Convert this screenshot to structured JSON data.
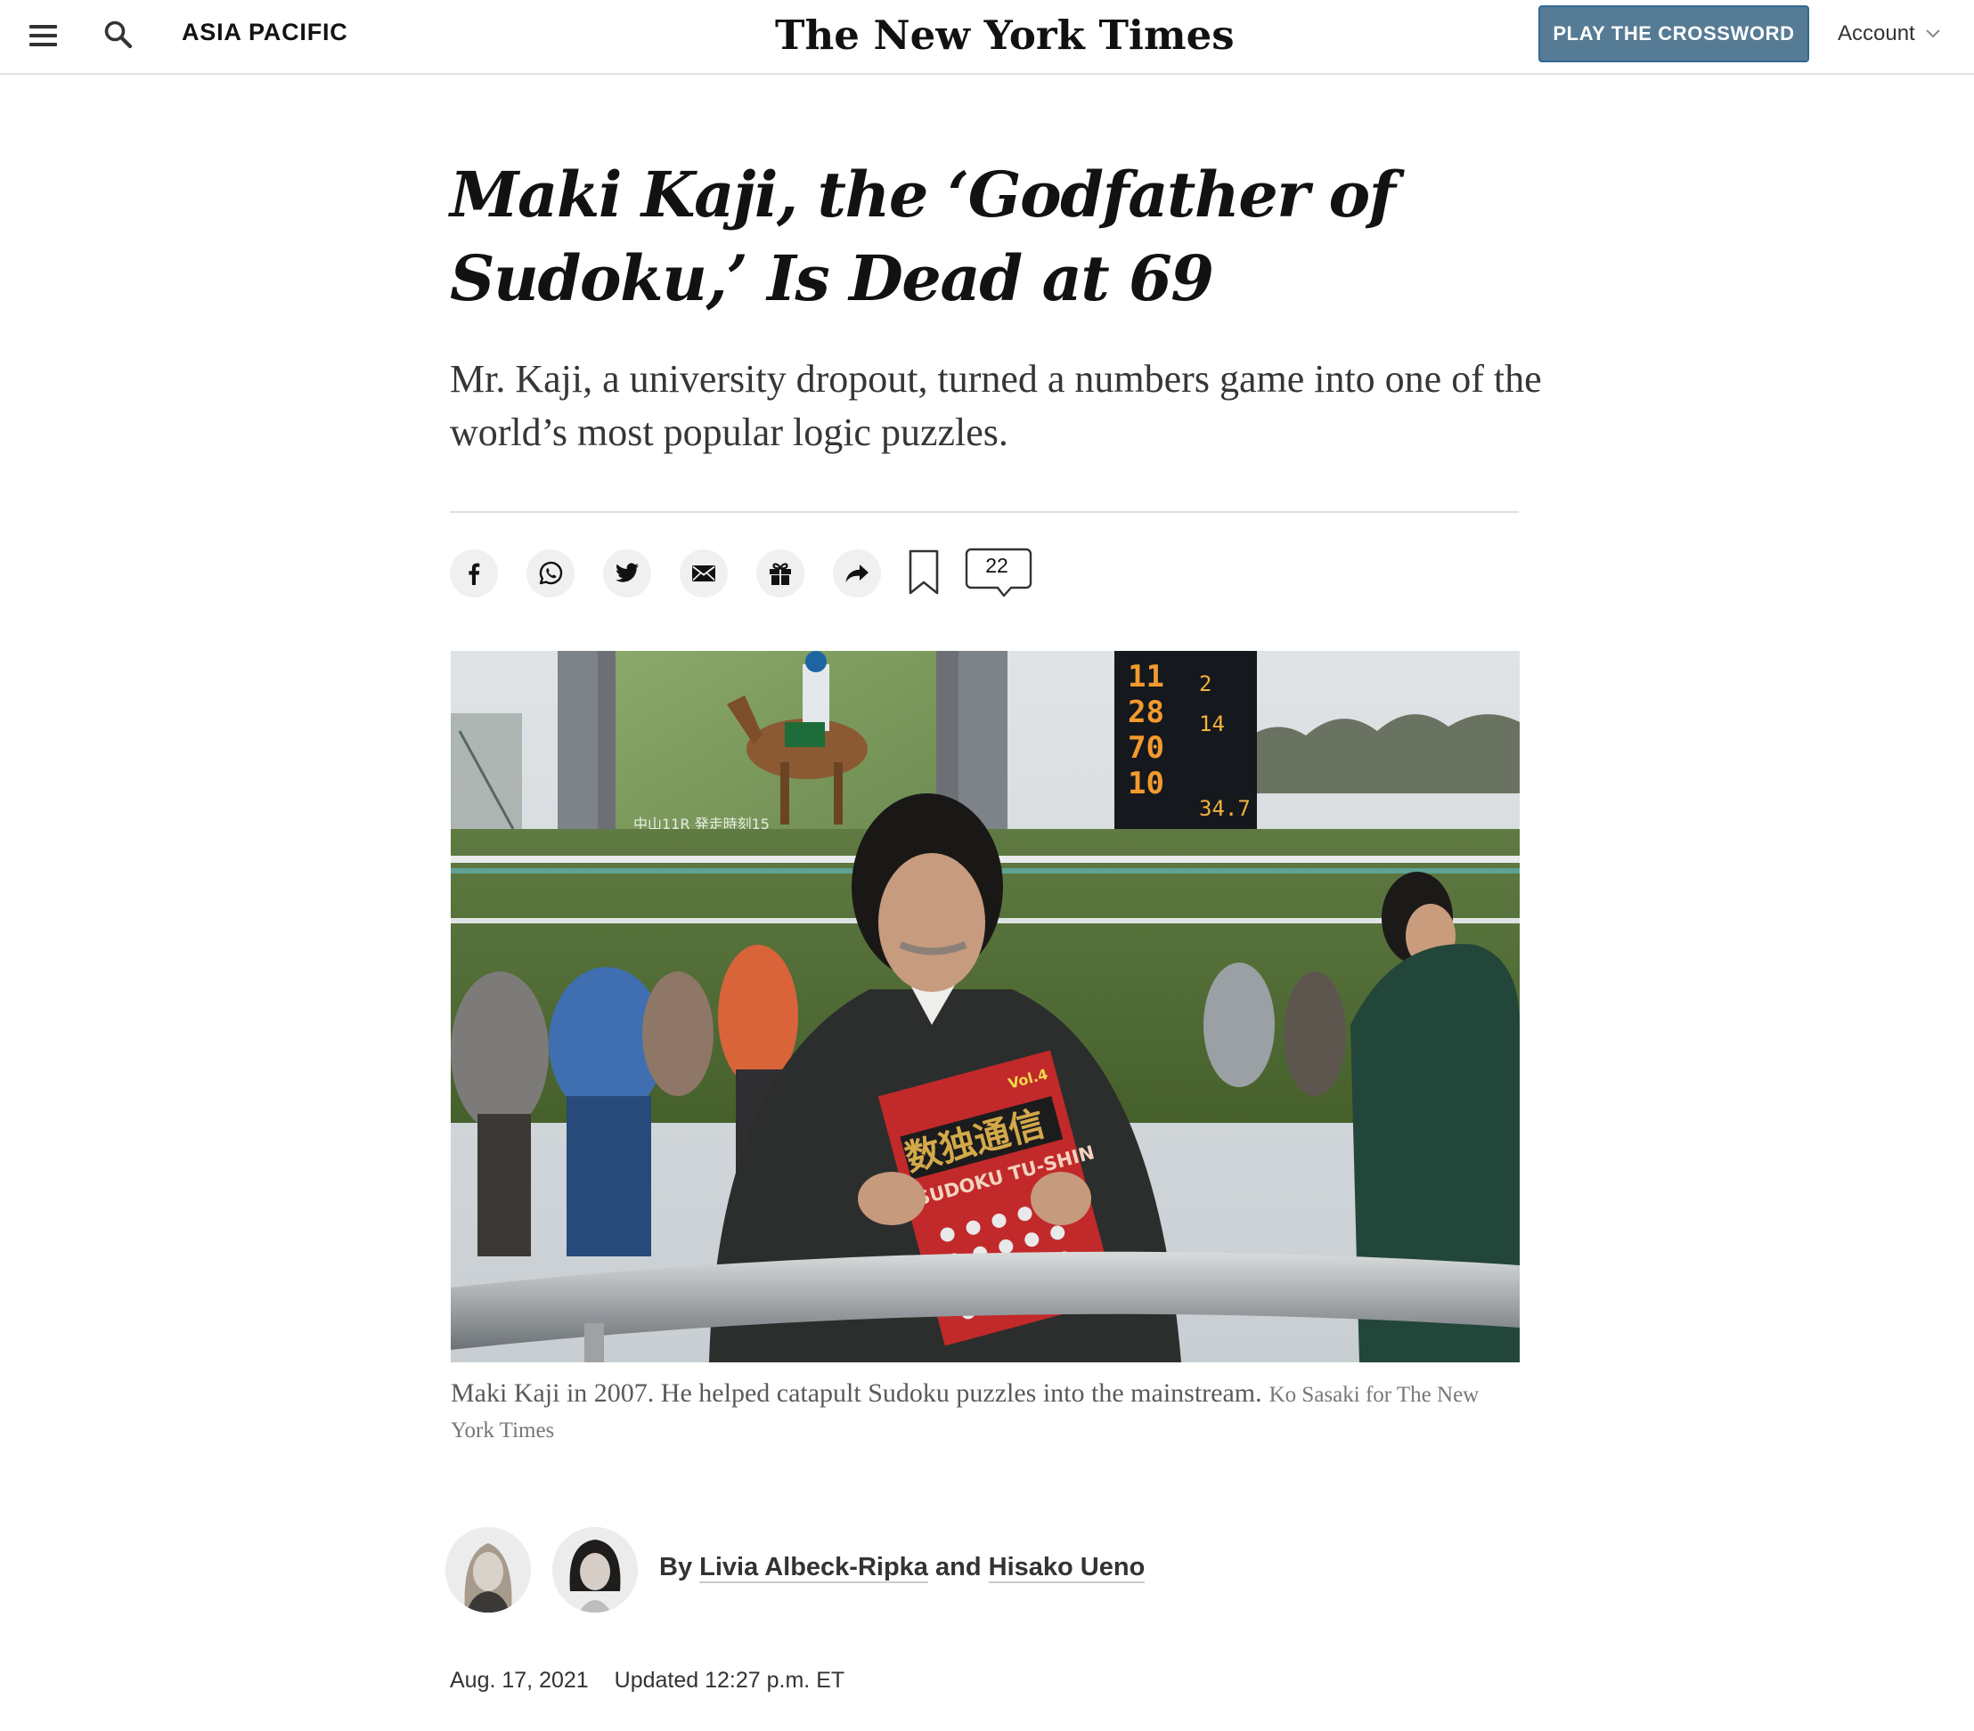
{
  "header": {
    "section": "ASIA PACIFIC",
    "masthead": "The New York Times",
    "crossword_button": "PLAY THE CROSSWORD",
    "account": "Account",
    "icons": [
      "hamburger-menu-icon",
      "search-icon",
      "chevron-down-icon"
    ]
  },
  "article": {
    "headline": "Maki Kaji, the ‘Godfather of Sudoku,’ Is Dead at 69",
    "summary": "Mr. Kaji, a university dropout, turned a numbers game into one of the world’s most popular logic puzzles.",
    "share_icons": [
      "facebook-icon",
      "whatsapp-icon",
      "twitter-icon",
      "email-icon",
      "gift-icon",
      "share-arrow-icon",
      "bookmark-icon"
    ],
    "comment_count": "22",
    "photo": {
      "scoreboard_text": "中山11R 発走時刻15",
      "book_title_jp": "数独通信",
      "book_title_en": "SUDOKU TU-SHIN",
      "book_volume": "Vol.4"
    },
    "caption": "Maki Kaji in 2007. He helped catapult Sudoku puzzles into the mainstream.",
    "credit": "Ko Sasaki for The New York Times",
    "byline": {
      "prefix": "By",
      "author1": "Livia Albeck-Ripka",
      "joiner": "and",
      "author2": "Hisako Ueno"
    },
    "date": "Aug. 17, 2021",
    "updated": "Updated 12:27 p.m. ET"
  }
}
